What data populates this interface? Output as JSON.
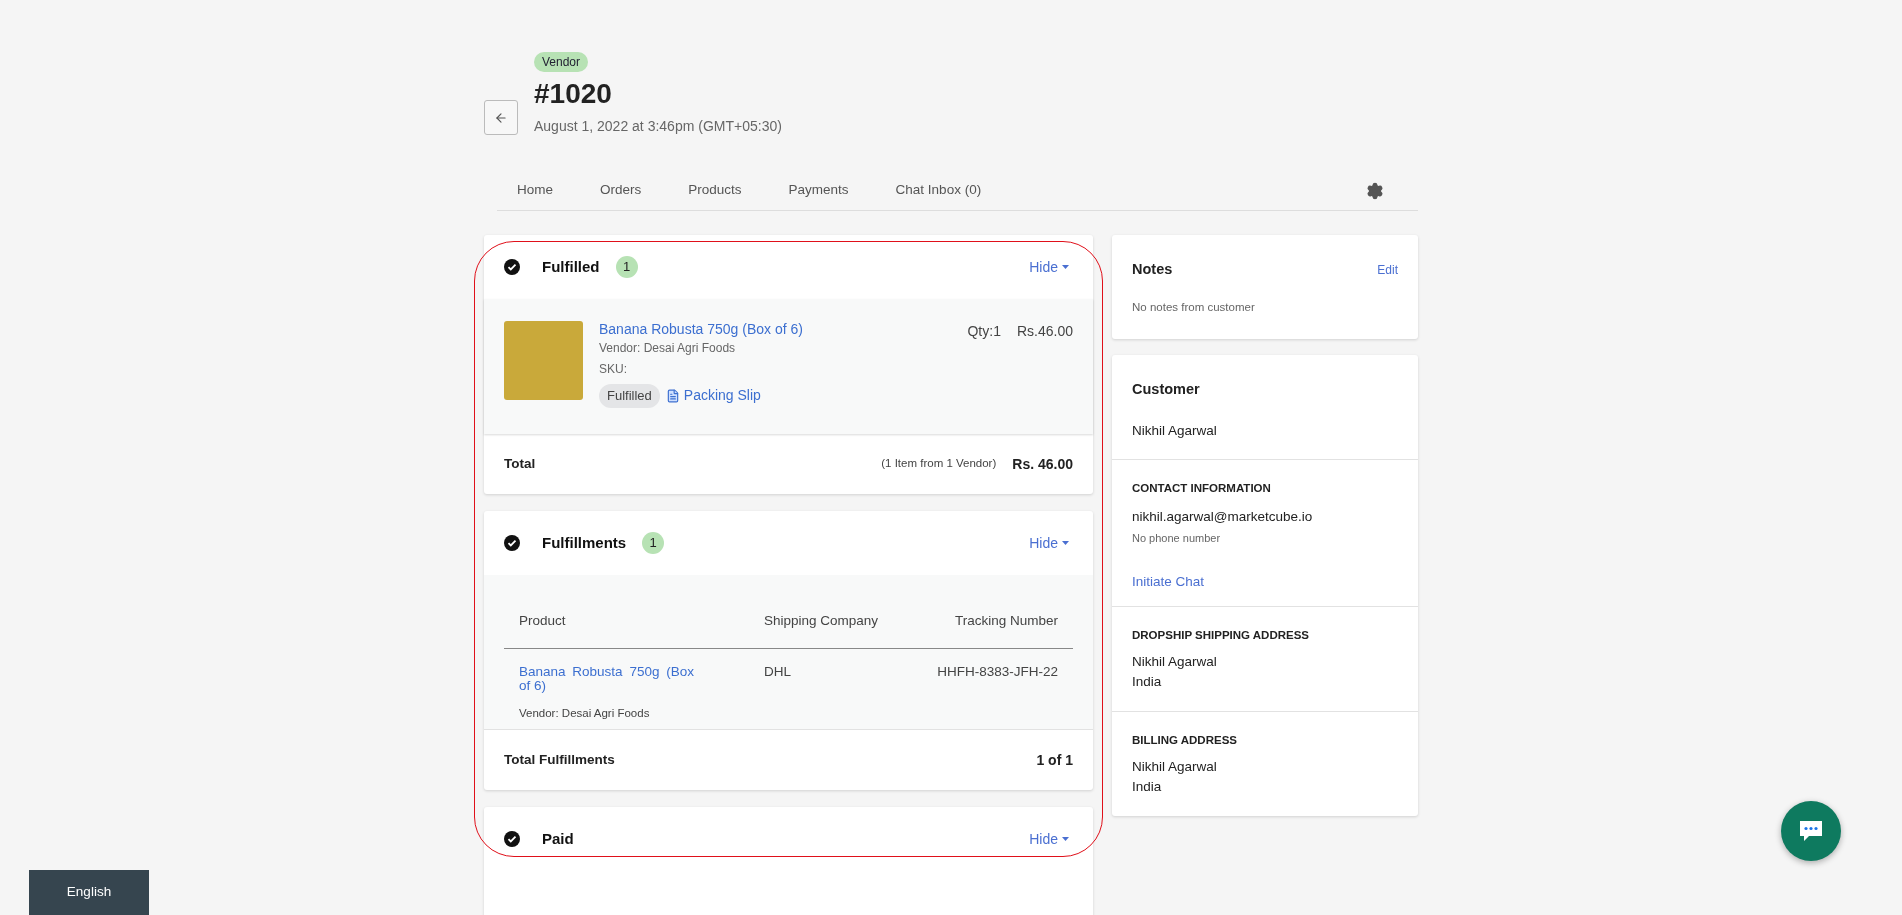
{
  "header": {
    "badge": "Vendor",
    "title": "#1020",
    "date": "August 1, 2022 at 3:46pm (GMT+05:30)"
  },
  "nav": [
    {
      "label": "Home"
    },
    {
      "label": "Orders"
    },
    {
      "label": "Products"
    },
    {
      "label": "Payments"
    },
    {
      "label": "Chat Inbox (0)"
    }
  ],
  "fulfilled": {
    "title": "Fulfilled",
    "count": "1",
    "toggle": "Hide",
    "item": {
      "name": "Banana Robusta 750g (Box of 6)",
      "vendor": "Vendor: Desai Agri Foods",
      "sku": "SKU:",
      "status": "Fulfilled",
      "slip": "Packing Slip",
      "qty": "Qty:1",
      "price": "Rs.46.00"
    },
    "total_label": "Total",
    "total_note": "(1 Item from 1 Vendor)",
    "total": "Rs. 46.00"
  },
  "fulfillments": {
    "title": "Fulfillments",
    "count": "1",
    "toggle": "Hide",
    "columns": [
      "Product",
      "Shipping Company",
      "Tracking Number"
    ],
    "rows": [
      {
        "product": "Banana Robusta 750g (Box of 6)",
        "vendor": "Vendor: Desai Agri Foods",
        "company": "DHL",
        "tracking": "HHFH-8383-JFH-22"
      }
    ],
    "total_label": "Total Fulfillments",
    "total": "1 of 1"
  },
  "paid": {
    "title": "Paid",
    "toggle": "Hide"
  },
  "notes": {
    "title": "Notes",
    "action": "Edit",
    "text": "No notes from customer"
  },
  "customer": {
    "title": "Customer",
    "name": "Nikhil Agarwal",
    "contact": {
      "heading": "CONTACT INFORMATION",
      "email": "nikhil.agarwal@marketcube.io",
      "phone": "No phone number",
      "chat": "Initiate Chat"
    },
    "addresses": [
      {
        "heading": "DROPSHIP SHIPPING ADDRESS",
        "lines": [
          "Nikhil Agarwal",
          "India"
        ]
      },
      {
        "heading": "BILLING ADDRESS",
        "lines": [
          "Nikhil Agarwal",
          "India"
        ]
      }
    ]
  },
  "language": "English"
}
